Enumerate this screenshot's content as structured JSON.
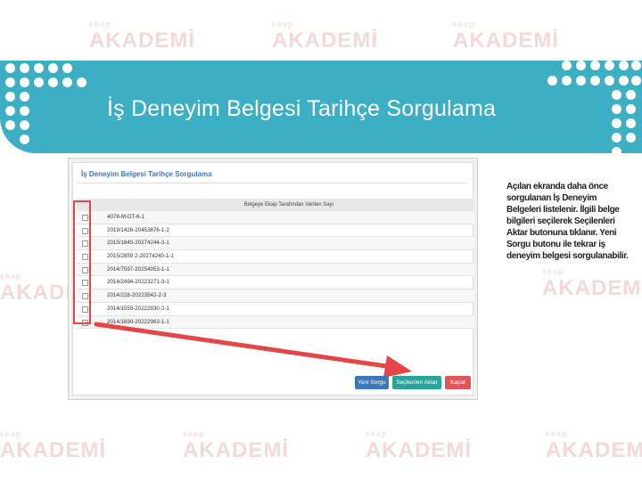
{
  "watermark": {
    "small": "ekap",
    "big": "AKADEMİ"
  },
  "banner": {
    "title": "İş Deneyim Belgesi Tarihçe Sorgulama"
  },
  "screenshot": {
    "panel_title": "İş Deneyim Belgesi Tarihçe Sorgulama",
    "column_header": "Belgeye Ekap Tarafından Verilen Sayı",
    "rows": [
      "4078-M-DT-6-1",
      "2019/1426-20453876-1-2",
      "2015/1845-20274244-3-1",
      "2015/2859 2-20274240-1-1",
      "2014/7597-20254053-1-1",
      "2014/2494-20223271-3-1",
      "2014/228-20223542-2-3",
      "2014/1559-20222930-2-1",
      "2014/1690-20222963-1-1"
    ],
    "buttons": {
      "new_query": "Yeni Sorgu",
      "transfer": "Seçilenleri Aktar",
      "close": "Kapat"
    }
  },
  "description": "Açılan ekranda daha önce sorgulanan İş Deneyim Belgeleri listelenir. İlgili belge bilgileri seçilerek Seçilenleri Aktar butonuna tıklanır. Yeni Sorgu butonu ile tekrar iş deneyim belgesi sorgulanabilir.",
  "colors": {
    "banner": "#3dafc4",
    "highlight": "#e64545",
    "arrow": "#e64545"
  }
}
